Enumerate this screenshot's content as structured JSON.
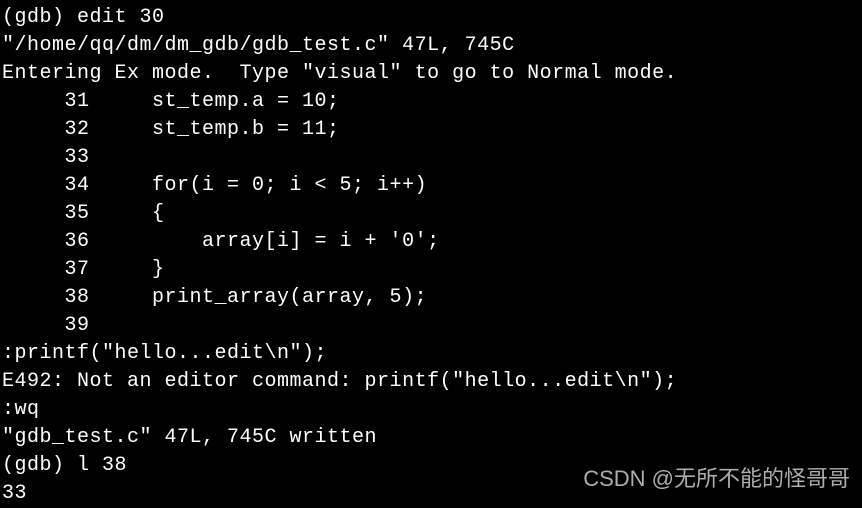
{
  "terminal": {
    "lines": [
      "(gdb) edit 30",
      "\"/home/qq/dm/dm_gdb/gdb_test.c\" 47L, 745C",
      "Entering Ex mode.  Type \"visual\" to go to Normal mode.",
      "     31     st_temp.a = 10;",
      "     32     st_temp.b = 11;",
      "     33",
      "     34     for(i = 0; i < 5; i++)",
      "     35     {",
      "     36         array[i] = i + '0';",
      "     37     }",
      "     38     print_array(array, 5);",
      "     39",
      ":printf(\"hello...edit\\n\");",
      "E492: Not an editor command: printf(\"hello...edit\\n\");",
      ":wq",
      "\"gdb_test.c\" 47L, 745C written",
      "(gdb) l 38",
      "33"
    ]
  },
  "watermark": {
    "text": "CSDN @无所不能的怪哥哥"
  }
}
